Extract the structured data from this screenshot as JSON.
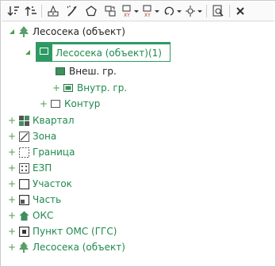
{
  "toolbar": {
    "buttons": [
      "sort-down-icon",
      "sort-up-icon",
      "edit-icon",
      "brush-icon",
      "pentagon-icon",
      "copy-layers-icon",
      "xy-transform-icon",
      "xy-transform-alt-icon",
      "rotate-icon",
      "pin-icon",
      "find-icon",
      "close-icon"
    ]
  },
  "tree": {
    "root": "Лесосека (объект)",
    "selected": "Лесосека (объект)(1)",
    "outer_border": "Внеш. гр.",
    "inner_border": "Внутр. гр.",
    "contour": "Контур",
    "items": [
      {
        "label": "Квартал",
        "icon": "quarter-icon"
      },
      {
        "label": "Зона",
        "icon": "zone-icon"
      },
      {
        "label": "Граница",
        "icon": "border-icon"
      },
      {
        "label": "ЕЗП",
        "icon": "ezp-icon"
      },
      {
        "label": "Участок",
        "icon": "plot-icon"
      },
      {
        "label": "Часть",
        "icon": "part-icon"
      },
      {
        "label": "ОКС",
        "icon": "oks-icon"
      },
      {
        "label": "Пункт ОМС (ГГС)",
        "icon": "oms-point-icon"
      },
      {
        "label": "Лесосека (объект)",
        "icon": "tree-icon"
      }
    ]
  },
  "colors": {
    "accent": "#2e9a63",
    "label": "#1f8a4c"
  }
}
